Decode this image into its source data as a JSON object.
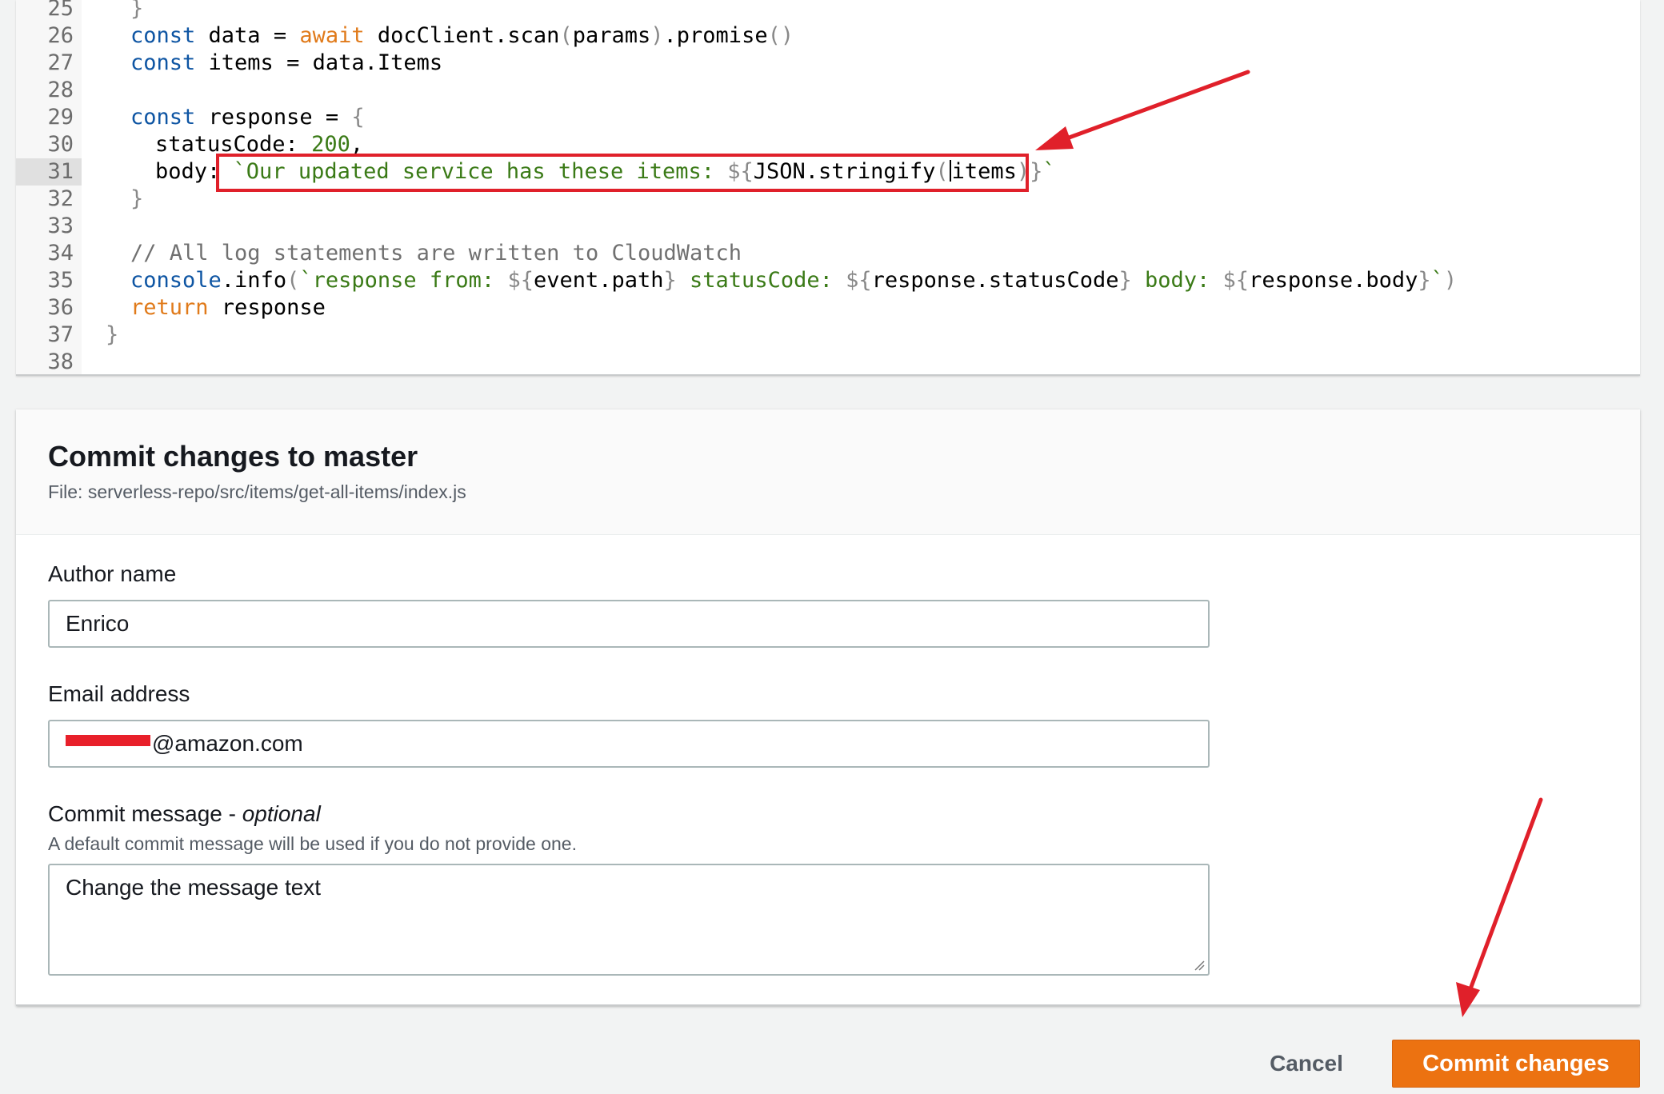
{
  "editor": {
    "lines": [
      {
        "num": "25"
      },
      {
        "num": "26"
      },
      {
        "num": "27"
      },
      {
        "num": "28"
      },
      {
        "num": "29"
      },
      {
        "num": "30"
      },
      {
        "num": "31"
      },
      {
        "num": "32"
      },
      {
        "num": "33"
      },
      {
        "num": "34"
      },
      {
        "num": "35"
      },
      {
        "num": "36"
      },
      {
        "num": "37"
      },
      {
        "num": "38"
      }
    ],
    "code": {
      "l25": "}",
      "l26_kw": "const",
      "l26_a": " data = ",
      "l26_aw": "await",
      "l26_b": " docClient.scan",
      "l26_p1": "(",
      "l26_c": "params",
      "l26_p2": ")",
      "l26_d": ".promise",
      "l26_p3": "()",
      "l27_kw": "const",
      "l27_a": " items = data.Items",
      "l29_kw": "const",
      "l29_a": " response = ",
      "l29_p": "{",
      "l30_a": "statusCode: ",
      "l30_n": "200",
      "l30_b": ",",
      "l31_a": "body: ",
      "l31_s1": "`Our updated service has these items: ",
      "l31_p1": "${",
      "l31_b": "JSON.stringify",
      "l31_p2": "(",
      "l31_c": "items",
      "l31_p3": ")}",
      "l31_s2": "`",
      "l32": "}",
      "l34": "// All log statements are written to CloudWatch",
      "l35_kw": "console",
      "l35_a": ".info",
      "l35_p1": "(",
      "l35_s1": "`response from: ",
      "l35_p2": "${",
      "l35_b": "event.path",
      "l35_p3": "}",
      "l35_s2": " statusCode: ",
      "l35_p4": "${",
      "l35_c": "response.statusCode",
      "l35_p5": "}",
      "l35_s3": " body: ",
      "l35_p6": "${",
      "l35_d": "response.body",
      "l35_p7": "}",
      "l35_s4": "`",
      "l35_p8": ")",
      "l36_kw": "return",
      "l36_a": " response",
      "l37": "}"
    }
  },
  "commit_panel": {
    "title": "Commit changes to master",
    "file_label": "File: serverless-repo/src/items/get-all-items/index.js",
    "author": {
      "label": "Author name",
      "value": "Enrico"
    },
    "email": {
      "label": "Email address",
      "value_visible": "@amazon.com"
    },
    "message": {
      "label": "Commit message - ",
      "label_optional": "optional",
      "description": "A default commit message will be used if you do not provide one.",
      "value": "Change the message text"
    }
  },
  "actions": {
    "cancel_label": "Cancel",
    "commit_label": "Commit changes"
  },
  "colors": {
    "accent": "#ec7211",
    "annotation": "#e0202a",
    "keyword": "#0e55a3",
    "string": "#3a7a16"
  }
}
